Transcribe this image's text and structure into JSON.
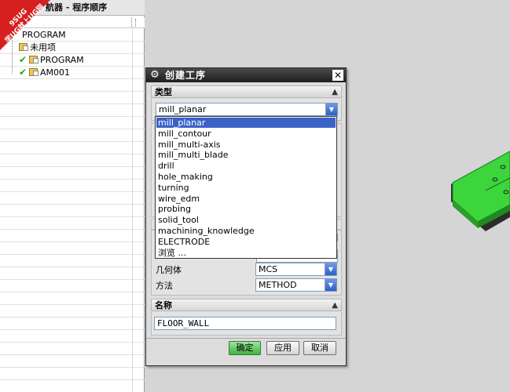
{
  "navigator": {
    "title": "航器 - 程序顺序",
    "items": [
      {
        "label": "PROGRAM",
        "indent": 0,
        "checked": false
      },
      {
        "label": "未用项",
        "indent": 1,
        "checked": false
      },
      {
        "label": "PROGRAM",
        "indent": 1,
        "checked": true
      },
      {
        "label": "AM001",
        "indent": 1,
        "checked": true
      }
    ]
  },
  "watermark": {
    "line1": "9SUG",
    "line2": "学UG就上UG网"
  },
  "dialog": {
    "title": "创建工序",
    "close_icon": "close-icon",
    "settings_icon": "gear-icon",
    "type_section": {
      "label": "类型",
      "value": "mill_planar"
    },
    "type_options": [
      "mill_planar",
      "mill_contour",
      "mill_multi-axis",
      "mill_multi_blade",
      "drill",
      "hole_making",
      "turning",
      "wire_edm",
      "probing",
      "solid_tool",
      "machining_knowledge",
      "ELECTRODE",
      "浏览 ..."
    ],
    "location": {
      "geometry_label": "几何体",
      "geometry_value": "MCS",
      "method_label": "方法",
      "method_value": "METHOD"
    },
    "name_section": {
      "label": "名称",
      "value": "FLOOR_WALL"
    },
    "buttons": {
      "ok": "确定",
      "apply": "应用",
      "cancel": "取消"
    }
  },
  "colors": {
    "accent": "#3a63c8",
    "part_green": "#3cd63c",
    "watermark_red": "#d61f1f"
  }
}
